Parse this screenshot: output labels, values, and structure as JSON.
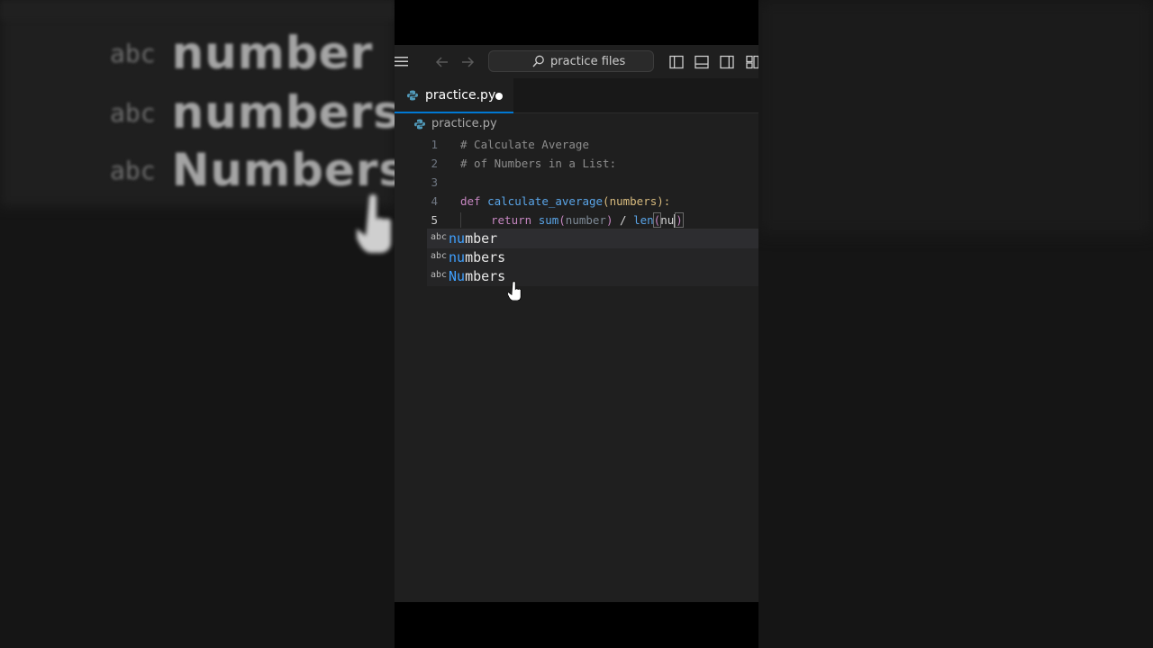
{
  "search": {
    "placeholder": "practice files"
  },
  "tab": {
    "filename": "practice.py",
    "modified": true
  },
  "breadcrumb": {
    "filename": "practice.py"
  },
  "code": {
    "lines": [
      {
        "n": "1",
        "text": "# Calculate Average"
      },
      {
        "n": "2",
        "text": "# of Numbers in a List:"
      },
      {
        "n": "3",
        "text": ""
      },
      {
        "n": "4",
        "keyword": "def",
        "function": "calculate_average",
        "param": "numbers",
        "tail": "):"
      },
      {
        "n": "5",
        "keyword": "return",
        "call1": "sum",
        "arg1": "number",
        "op": "/",
        "call2": "len",
        "arg2": "nu"
      }
    ]
  },
  "suggestions": [
    {
      "kind": "abc",
      "match": "nu",
      "rest": "mber"
    },
    {
      "kind": "abc",
      "match": "nu",
      "rest": "mbers"
    },
    {
      "kind": "abc",
      "match": "Nu",
      "rest": "mbers"
    }
  ],
  "background": {
    "words": [
      {
        "kind": "abc",
        "text": "number"
      },
      {
        "kind": "abc",
        "text": "numbers"
      },
      {
        "kind": "abc",
        "text": "Numbers"
      }
    ]
  },
  "colors": {
    "accent": "#0078d4",
    "editor_bg": "#1f1f1f",
    "keyword": "#c586c0",
    "function": "#5aa5e8",
    "param": "#d7ba7d"
  }
}
